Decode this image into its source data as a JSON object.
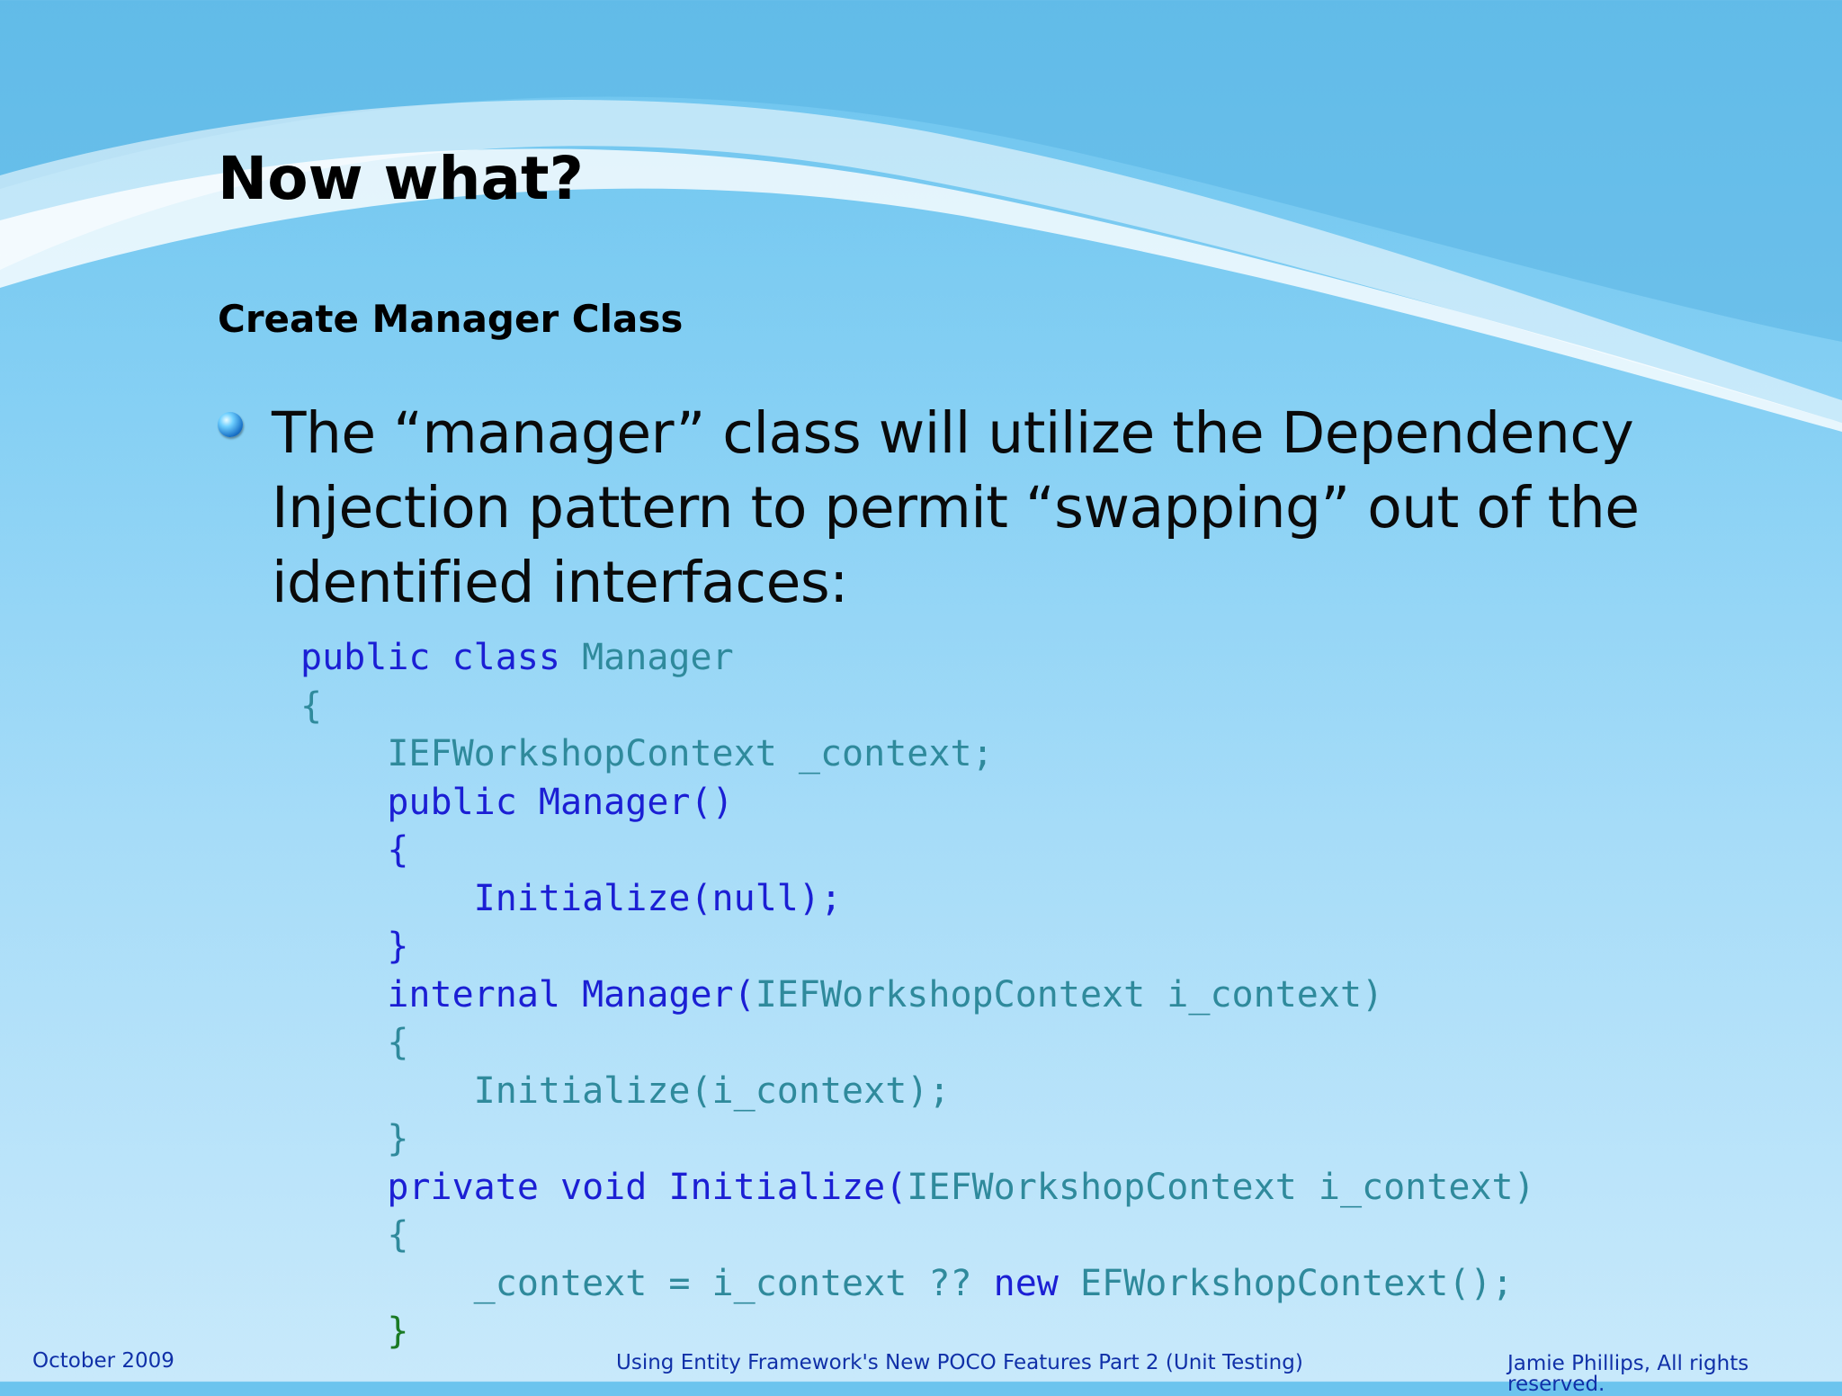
{
  "slide": {
    "title": "Now what?",
    "subtitle": "Create Manager Class",
    "bullet": "The “manager” class will utilize the Dependency Injection pattern to permit “swapping” out of the identified interfaces:"
  },
  "code": {
    "lines": [
      [
        {
          "t": "public class ",
          "c": "kw"
        },
        {
          "t": "Manager",
          "c": "ty"
        }
      ],
      [
        {
          "t": "{",
          "c": "pl"
        }
      ],
      [
        {
          "t": "    IEFWorkshopContext _context;",
          "c": "pl"
        }
      ],
      [
        {
          "t": "    public Manager()",
          "c": "kw"
        }
      ],
      [
        {
          "t": "    {",
          "c": "kw"
        }
      ],
      [
        {
          "t": "        Initialize(null);",
          "c": "kw"
        }
      ],
      [
        {
          "t": "    }",
          "c": "kw"
        }
      ],
      [
        {
          "t": "    internal Manager(",
          "c": "kw"
        },
        {
          "t": "IEFWorkshopContext i_context)",
          "c": "pl"
        }
      ],
      [
        {
          "t": "    {",
          "c": "pl"
        }
      ],
      [
        {
          "t": "        Initialize(i_context);",
          "c": "pl"
        }
      ],
      [
        {
          "t": "    }",
          "c": "pl"
        }
      ],
      [
        {
          "t": "    private void Initialize(",
          "c": "kw"
        },
        {
          "t": "IEFWorkshopContext i_context)",
          "c": "pl"
        }
      ],
      [
        {
          "t": "    {",
          "c": "pl"
        }
      ],
      [
        {
          "t": "        _context = i_context ?? ",
          "c": "pl"
        },
        {
          "t": "new ",
          "c": "kw"
        },
        {
          "t": "EFWorkshopContext();",
          "c": "pl"
        }
      ],
      [
        {
          "t": "    }",
          "c": "gr"
        }
      ]
    ]
  },
  "footer": {
    "date": "October 2009",
    "center": "Using Entity Framework's New POCO Features Part 2 (Unit Testing)",
    "right": "Jamie Phillips, All rights reserved."
  },
  "colors": {
    "keyword": "#1b1fd4",
    "type": "#2f8a9c",
    "footer": "#1030a8"
  }
}
